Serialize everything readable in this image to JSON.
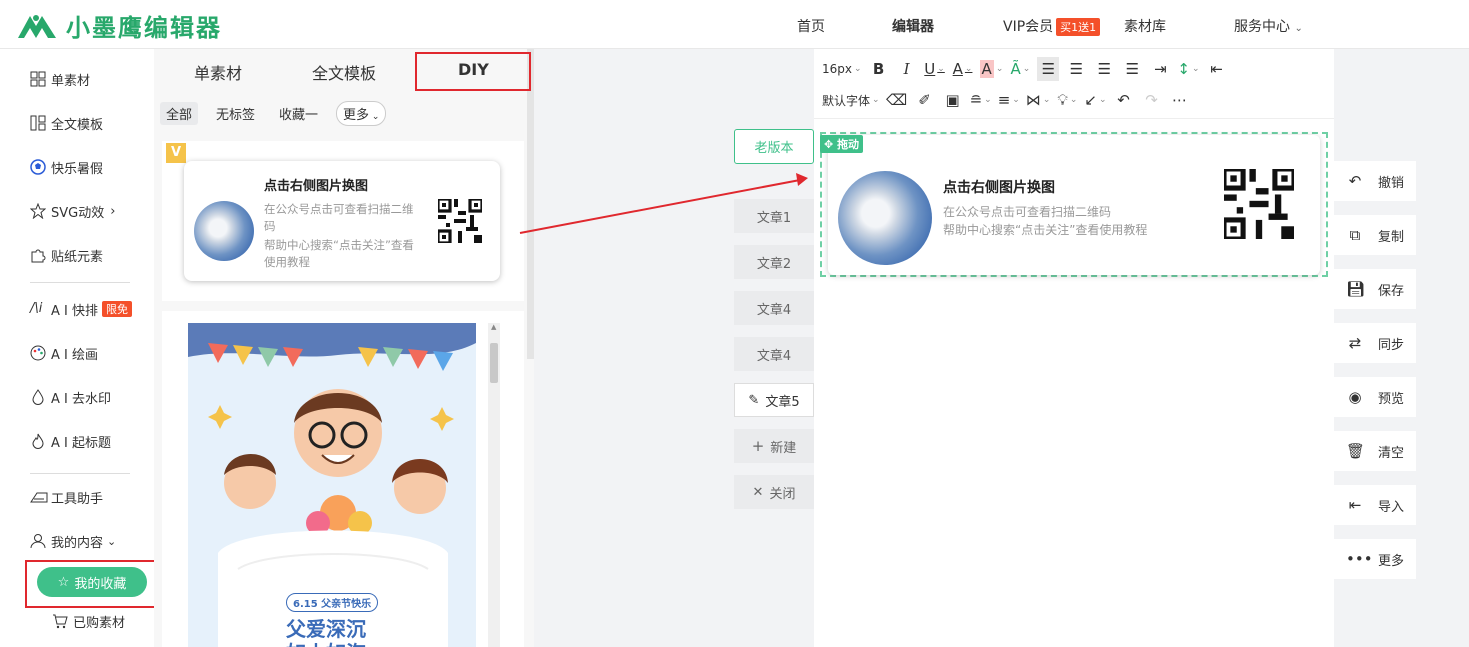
{
  "brand": {
    "name": "小墨鹰编辑器",
    "color": "#28a86b"
  },
  "topnav": {
    "home": "首页",
    "editor": "编辑器",
    "vip": "VIP会员",
    "vip_badge": "买1送1",
    "library": "素材库",
    "service": "服务中心"
  },
  "sidebar": {
    "items": [
      {
        "label": "单素材",
        "icon": "grid-icon"
      },
      {
        "label": "全文模板",
        "icon": "template-icon"
      },
      {
        "label": "快乐暑假",
        "icon": "football-icon"
      },
      {
        "label": "SVG动效",
        "icon": "star-icon"
      },
      {
        "label": "贴纸元素",
        "icon": "puzzle-icon"
      },
      {
        "label": "A I 快排",
        "icon": "ai-icon",
        "badge": "限免"
      },
      {
        "label": "A I 绘画",
        "icon": "palette-icon"
      },
      {
        "label": "A I 去水印",
        "icon": "drop-icon"
      },
      {
        "label": "A I 起标题",
        "icon": "fire-icon"
      },
      {
        "label": "工具助手",
        "icon": "tool-icon"
      },
      {
        "label": "我的内容",
        "icon": "user-icon"
      },
      {
        "label": "我的收藏",
        "icon": "star-outline-icon"
      },
      {
        "label": "已购素材",
        "icon": "cart-icon"
      }
    ]
  },
  "panel": {
    "tabs": [
      "单素材",
      "全文模板",
      "DIY"
    ],
    "filters": [
      "全部",
      "无标签",
      "收藏一",
      "更多"
    ],
    "card": {
      "title": "点击右侧图片换图",
      "text1": "在公众号点击可查看扫描二维码",
      "text2": "帮助中心搜索“点击关注”查看使用教程"
    },
    "poster": {
      "badge": "6.15 父亲节快乐",
      "title1": "父爱深沉",
      "title2": "如山如海"
    }
  },
  "doc_tabs": {
    "old_version": "老版本",
    "items": [
      "文章1",
      "文章2",
      "文章4",
      "文章4",
      "文章5"
    ],
    "new": "新建",
    "close": "关闭"
  },
  "editor": {
    "font_size": "16px",
    "font_family": "默认字体",
    "drag_label": "拖动",
    "card": {
      "title": "点击右侧图片换图",
      "text1": "在公众号点击可查看扫描二维码",
      "text2": "帮助中心搜索“点击关注”查看使用教程"
    }
  },
  "actions": [
    "撤销",
    "复制",
    "保存",
    "同步",
    "预览",
    "清空",
    "导入",
    "更多"
  ]
}
